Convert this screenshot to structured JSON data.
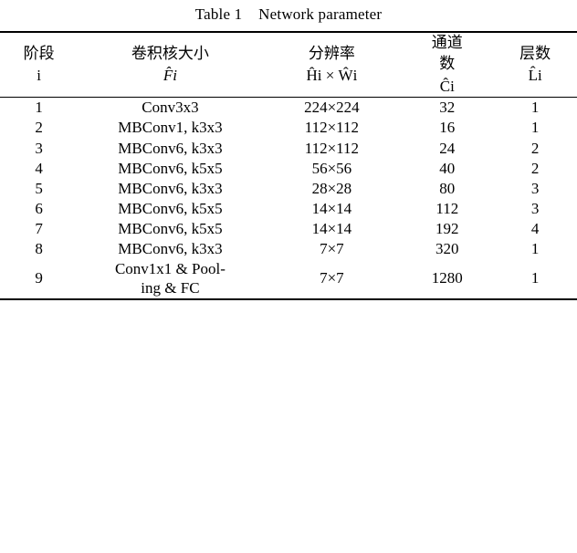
{
  "caption": {
    "label": "Table 1",
    "title": "Network parameter",
    "full": "Table 1    Network parameter"
  },
  "table": {
    "headers": [
      {
        "line1": "阶段",
        "line2": "i"
      },
      {
        "line1": "卷积核大小",
        "line2": "F̂i"
      },
      {
        "line1": "分辨率",
        "line2": "Ĥi × Ŵi"
      },
      {
        "line1": "通道",
        "line2": "数",
        "line3": "Ĉi"
      },
      {
        "line1": "层数",
        "line2": "L̂i"
      }
    ],
    "rows": [
      {
        "stage": "1",
        "operator": "Conv3x3",
        "resolution": "224×224",
        "channels": "32",
        "layers": "1"
      },
      {
        "stage": "2",
        "operator": "MBConv1, k3x3",
        "resolution": "112×112",
        "channels": "16",
        "layers": "1"
      },
      {
        "stage": "3",
        "operator": "MBConv6, k3x3",
        "resolution": "112×112",
        "channels": "24",
        "layers": "2"
      },
      {
        "stage": "4",
        "operator": "MBConv6, k5x5",
        "resolution": "56×56",
        "channels": "40",
        "layers": "2"
      },
      {
        "stage": "5",
        "operator": "MBConv6, k3x3",
        "resolution": "28×28",
        "channels": "80",
        "layers": "3"
      },
      {
        "stage": "6",
        "operator": "MBConv6, k5x5",
        "resolution": "14×14",
        "channels": "112",
        "layers": "3"
      },
      {
        "stage": "7",
        "operator": "MBConv6, k5x5",
        "resolution": "14×14",
        "channels": "192",
        "layers": "4"
      },
      {
        "stage": "8",
        "operator": "MBConv6, k3x3",
        "resolution": "7×7",
        "channels": "320",
        "layers": "1"
      },
      {
        "stage": "9",
        "operator": "Conv1x1 & Pool-\ning & FC",
        "operator_line1": "Conv1x1 & Pool-",
        "operator_line2": "ing & FC",
        "resolution": "7×7",
        "channels": "1280",
        "layers": "1"
      }
    ]
  }
}
